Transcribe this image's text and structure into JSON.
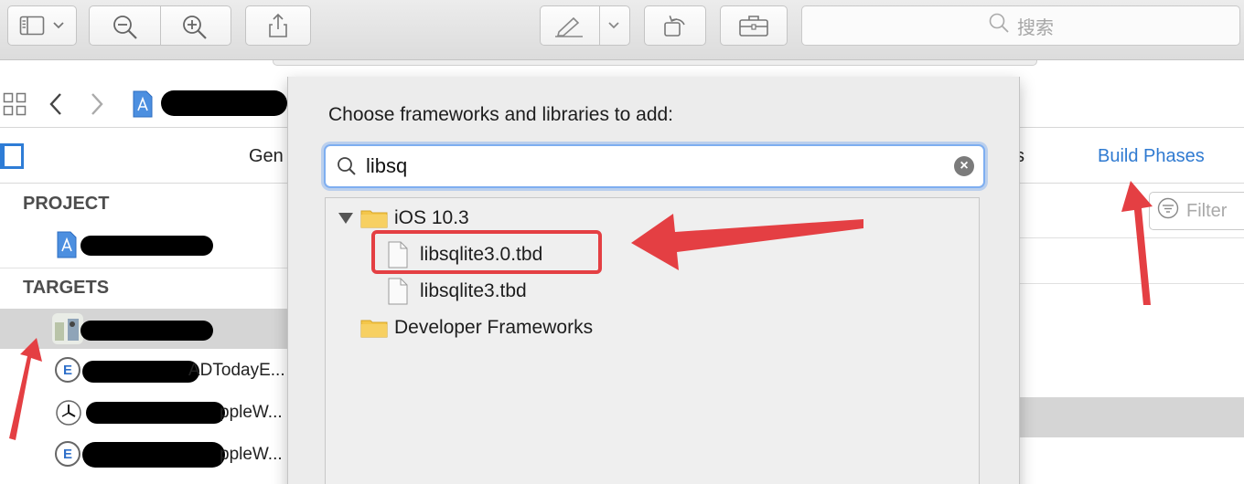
{
  "toolbar": {
    "search_placeholder": "搜索",
    "icons": [
      "sidebar-toggle-icon",
      "chevron-down-icon",
      "zoom-out-icon",
      "zoom-in-icon",
      "share-icon",
      "markup-icon",
      "chevron-down-icon",
      "rotate-icon",
      "toolbox-icon",
      "search-icon"
    ]
  },
  "jumpbar": {
    "icons": [
      "grid-icon",
      "back-icon",
      "forward-icon",
      "project-file-icon"
    ]
  },
  "tabs": {
    "general": "Gen",
    "capabilities_tail": "s",
    "build_phases": "Build Phases"
  },
  "sidebar": {
    "project_header": "PROJECT",
    "targets_header": "TARGETS",
    "target_rows": [
      {
        "visible_text": ""
      },
      {
        "visible_text": "ADTodayE..."
      },
      {
        "visible_text": "ppleW..."
      },
      {
        "visible_text": "ppleW..."
      }
    ]
  },
  "filter": {
    "placeholder": "Filter"
  },
  "dialog": {
    "title": "Choose frameworks and libraries to add:",
    "search_value": "libsq",
    "tree": {
      "group1": "iOS 10.3",
      "items": [
        "libsqlite3.0.tbd",
        "libsqlite3.tbd"
      ],
      "group2": "Developer Frameworks"
    }
  },
  "colors": {
    "accent_blue": "#2f7ad1",
    "annotation_red": "#e43f43",
    "selection_gray": "#d5d5d5",
    "dialog_bg": "#ececec"
  }
}
